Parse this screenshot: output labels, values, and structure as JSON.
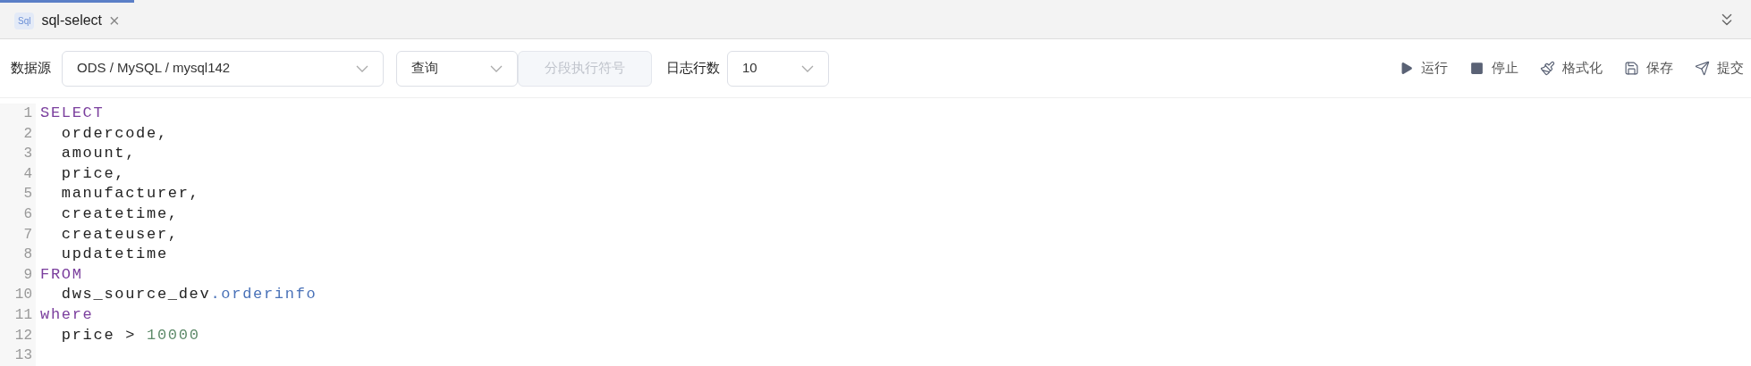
{
  "tabs": [
    {
      "badge": "Sql",
      "label": "sql-select",
      "selected": true,
      "close": "×"
    }
  ],
  "toolbar": {
    "datasource_label": "数据源",
    "datasource": "ODS / MySQL / mysql142",
    "mode": "查询",
    "segment_button": {
      "label": "分段执行符号",
      "disabled": true
    },
    "log_rows_label": "日志行数",
    "log_rows": "10",
    "actions": [
      {
        "kind": "run",
        "label": "运行"
      },
      {
        "kind": "stop",
        "label": "停止"
      },
      {
        "kind": "format",
        "label": "格式化"
      },
      {
        "kind": "save",
        "label": "保存"
      },
      {
        "kind": "submit",
        "label": "提交"
      }
    ]
  },
  "editor": {
    "lines": [
      {
        "number": "1",
        "tokens": [
          {
            "kind": "keyword",
            "text": "SELECT"
          }
        ]
      },
      {
        "number": "2",
        "tokens": [
          {
            "kind": "plain",
            "text": "  ordercode,"
          }
        ]
      },
      {
        "number": "3",
        "tokens": [
          {
            "kind": "plain",
            "text": "  amount,"
          }
        ]
      },
      {
        "number": "4",
        "tokens": [
          {
            "kind": "plain",
            "text": "  price,"
          }
        ]
      },
      {
        "number": "5",
        "tokens": [
          {
            "kind": "plain",
            "text": "  manufacturer,"
          }
        ]
      },
      {
        "number": "6",
        "tokens": [
          {
            "kind": "plain",
            "text": "  createtime,"
          }
        ]
      },
      {
        "number": "7",
        "tokens": [
          {
            "kind": "plain",
            "text": "  createuser,"
          }
        ]
      },
      {
        "number": "8",
        "tokens": [
          {
            "kind": "plain",
            "text": "  updatetime"
          }
        ]
      },
      {
        "number": "9",
        "tokens": [
          {
            "kind": "keyword",
            "text": "FROM"
          }
        ]
      },
      {
        "number": "10",
        "tokens": [
          {
            "kind": "plain",
            "text": "  dws_source_dev"
          },
          {
            "kind": "property",
            "text": ".orderinfo"
          }
        ]
      },
      {
        "number": "11",
        "tokens": [
          {
            "kind": "keyword",
            "text": "where"
          }
        ]
      },
      {
        "number": "12",
        "tokens": [
          {
            "kind": "plain",
            "text": "  price > "
          },
          {
            "kind": "number",
            "text": "10000"
          }
        ]
      },
      {
        "number": "13"
      }
    ]
  }
}
